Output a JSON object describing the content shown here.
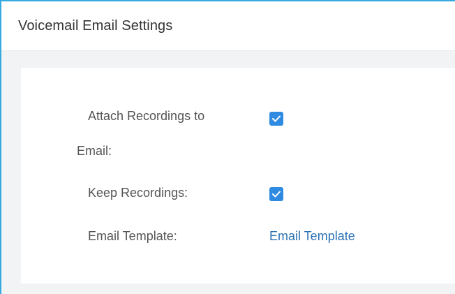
{
  "panel": {
    "title": "Voicemail Email Settings"
  },
  "form": {
    "attach_recordings": {
      "label_line1": "Attach Recordings to",
      "label_line2": "Email:",
      "checked": true
    },
    "keep_recordings": {
      "label": "Keep Recordings:",
      "checked": true
    },
    "email_template": {
      "label": "Email Template:",
      "link_text": "Email Template"
    }
  },
  "colors": {
    "frame_accent": "#36a9e1",
    "checkbox_fill": "#2f8ae1",
    "link": "#2b73b5",
    "body_background": "#f2f3f5"
  }
}
